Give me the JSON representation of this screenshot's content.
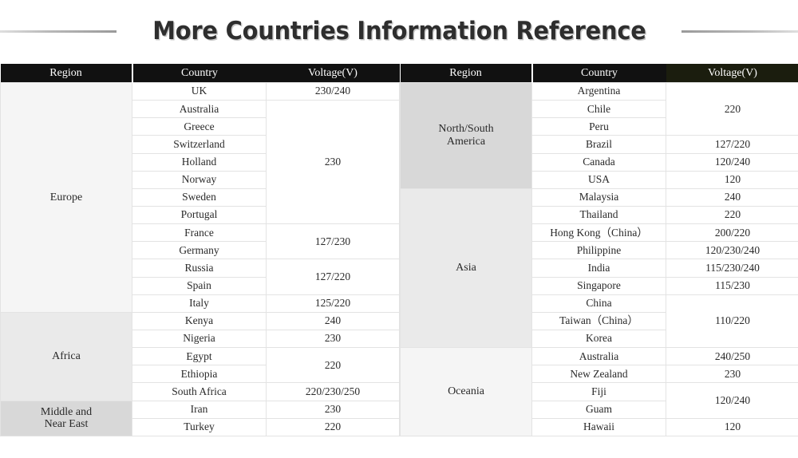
{
  "title": "More Countries Information Reference",
  "decor": {
    "rule_left": "horizontal-rule-left",
    "rule_right": "horizontal-rule-right"
  },
  "colors": {
    "header_bg": "#111111",
    "header_accent_bg": "#1b1d0e",
    "header_text": "#ffffff",
    "tone_light": "#f5f5f5",
    "tone_mid": "#eaeaea",
    "tone_dark": "#d8d8d8",
    "grid_line": "#e3e3e3",
    "title_text": "#2e2e2e"
  },
  "tables": [
    {
      "id": "left-table",
      "headers": {
        "region": "Region",
        "country": "Country",
        "voltage": "Voltage(V)",
        "voltage_accent": false
      },
      "regions": [
        {
          "name": "Europe",
          "tone": "tone-a",
          "rows": 13,
          "countries": [
            "UK",
            "Australia",
            "Greece",
            "Switzerland",
            "Holland",
            "Norway",
            "Sweden",
            "Portugal",
            "France",
            "Germany",
            "Russia",
            "Spain",
            "Italy"
          ],
          "voltages": [
            {
              "value": "230/240",
              "span": 1
            },
            {
              "value": "230",
              "span": 7
            },
            {
              "value": "127/230",
              "span": 2
            },
            {
              "value": "127/220",
              "span": 2
            },
            {
              "value": "125/220",
              "span": 1
            }
          ]
        },
        {
          "name": "Africa",
          "tone": "tone-b",
          "rows": 5,
          "countries": [
            "Kenya",
            "Nigeria",
            "Egypt",
            "Ethiopia",
            "South Africa"
          ],
          "voltages": [
            {
              "value": "240",
              "span": 1
            },
            {
              "value": "230",
              "span": 1
            },
            {
              "value": "220",
              "span": 2
            },
            {
              "value": "220/230/250",
              "span": 1
            }
          ]
        },
        {
          "name": "Middle and\nNear East",
          "tone": "tone-c",
          "rows": 2,
          "countries": [
            "Iran",
            "Turkey"
          ],
          "voltages": [
            {
              "value": "230",
              "span": 1
            },
            {
              "value": "220",
              "span": 1
            }
          ]
        }
      ]
    },
    {
      "id": "right-table",
      "headers": {
        "region": "Region",
        "country": "Country",
        "voltage": "Voltage(V)",
        "voltage_accent": true
      },
      "regions": [
        {
          "name": "North/South\nAmerica",
          "tone": "tone-c",
          "rows": 6,
          "countries": [
            "Argentina",
            "Chile",
            "Peru",
            "Brazil",
            "Canada",
            "USA"
          ],
          "voltages": [
            {
              "value": "220",
              "span": 3
            },
            {
              "value": "127/220",
              "span": 1
            },
            {
              "value": "120/240",
              "span": 1
            },
            {
              "value": "120",
              "span": 1
            }
          ]
        },
        {
          "name": "Asia",
          "tone": "tone-b",
          "rows": 9,
          "countries": [
            "Malaysia",
            "Thailand",
            "Hong Kong（China）",
            "Philippine",
            "India",
            "Singapore",
            "China",
            "Taiwan（China）",
            "Korea"
          ],
          "voltages": [
            {
              "value": "240",
              "span": 1
            },
            {
              "value": "220",
              "span": 1
            },
            {
              "value": "200/220",
              "span": 1
            },
            {
              "value": "120/230/240",
              "span": 1
            },
            {
              "value": "115/230/240",
              "span": 1
            },
            {
              "value": "115/230",
              "span": 1
            },
            {
              "value": "110/220",
              "span": 3
            }
          ]
        },
        {
          "name": "Oceania",
          "tone": "tone-a",
          "rows": 5,
          "countries": [
            "Australia",
            "New Zealand",
            "Fiji",
            "Guam",
            "Hawaii"
          ],
          "voltages": [
            {
              "value": "240/250",
              "span": 1
            },
            {
              "value": "230",
              "span": 1
            },
            {
              "value": "120/240",
              "span": 2
            },
            {
              "value": "120",
              "span": 1
            }
          ]
        }
      ]
    }
  ]
}
